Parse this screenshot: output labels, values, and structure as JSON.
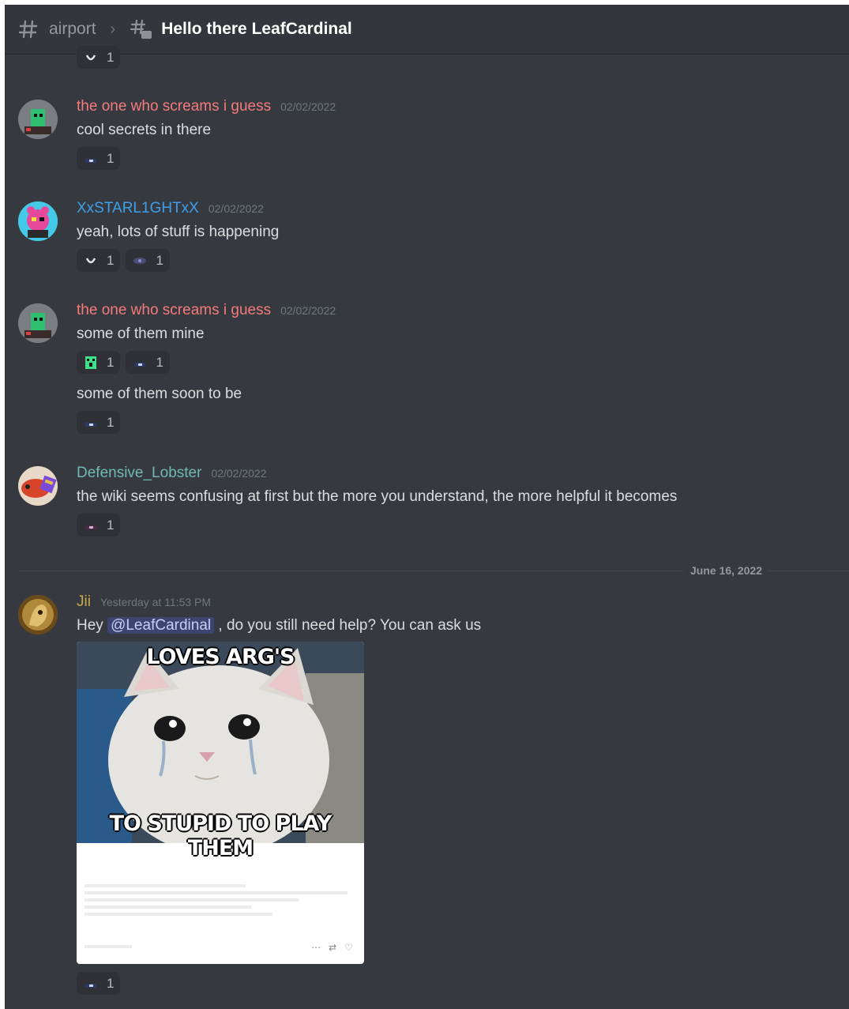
{
  "header": {
    "channel_name": "airport",
    "separator": "›",
    "thread_title": "Hello there LeafCardinal"
  },
  "colors": {
    "background": "#36393f",
    "username_red": "#f47b7b",
    "username_blue": "#3ea0e8",
    "username_teal": "#6fb8b4",
    "username_gold": "#c9a94a",
    "mention_bg": "#3e4470"
  },
  "messages": [
    {
      "author": "the one who screams i guess",
      "timestamp": "02/02/2022",
      "text": "cool secrets in there",
      "reactions": [
        {
          "emoji": "sad-face-emoji",
          "count": "1"
        }
      ]
    },
    {
      "author": "XxSTARL1GHTxX",
      "timestamp": "02/02/2022",
      "text": "yeah, lots of stuff is happening",
      "reactions": [
        {
          "emoji": "smile-emoji",
          "count": "1"
        },
        {
          "emoji": "eye-emoji",
          "count": "1"
        }
      ]
    },
    {
      "author": "the one who screams i guess",
      "timestamp": "02/02/2022",
      "text": "some of them mine",
      "reactions": [
        {
          "emoji": "creeper-emoji",
          "count": "1"
        },
        {
          "emoji": "sad-face-emoji",
          "count": "1"
        }
      ],
      "followup_text": "some of them soon to be",
      "followup_reactions": [
        {
          "emoji": "sad-face-emoji",
          "count": "1"
        }
      ]
    },
    {
      "author": "Defensive_Lobster",
      "timestamp": "02/02/2022",
      "text": "the wiki seems confusing at first but the more you understand, the more helpful it becomes",
      "reactions": [
        {
          "emoji": "sad-face-emoji",
          "count": "1"
        }
      ]
    }
  ],
  "date_divider": "June 16, 2022",
  "last_message": {
    "author": "Jii",
    "timestamp": "Yesterday at 11:53 PM",
    "text_before": "Hey ",
    "mention": "@LeafCardinal",
    "text_after": " , do you still need help? You can ask us",
    "reactions": [
      {
        "emoji": "sad-face-emoji",
        "count": "1"
      }
    ],
    "meme": {
      "top_text": "LOVES ARG'S",
      "bottom_text": "TO STUPID TO PLAY THEM"
    }
  },
  "top_partial_reaction": {
    "emoji": "smile-emoji",
    "count": "1"
  }
}
